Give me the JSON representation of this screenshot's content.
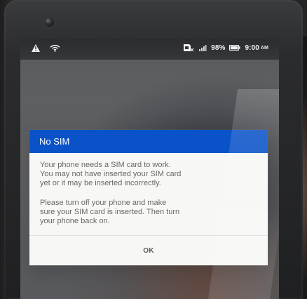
{
  "status_bar": {
    "battery_percent": "98%",
    "time": "9:00",
    "am_pm": "AM",
    "icons": [
      "warning-icon",
      "wifi-icon",
      "sim-card-icon",
      "signal-icon",
      "battery-icon"
    ]
  },
  "dialog": {
    "title": "No SIM",
    "paragraph_1": "Your phone needs a SIM card to work.\nYou may not have inserted your SIM card\nyet or it may be inserted incorrectly.",
    "paragraph_2": "Please turn off your phone and make\nsure your SIM card is inserted. Then turn\nyour phone back on.",
    "ok_label": "OK"
  },
  "colors": {
    "dialog_header": "#0a52c8",
    "dialog_background": "#f7f7f5",
    "status_text": "#f0f0f0"
  }
}
